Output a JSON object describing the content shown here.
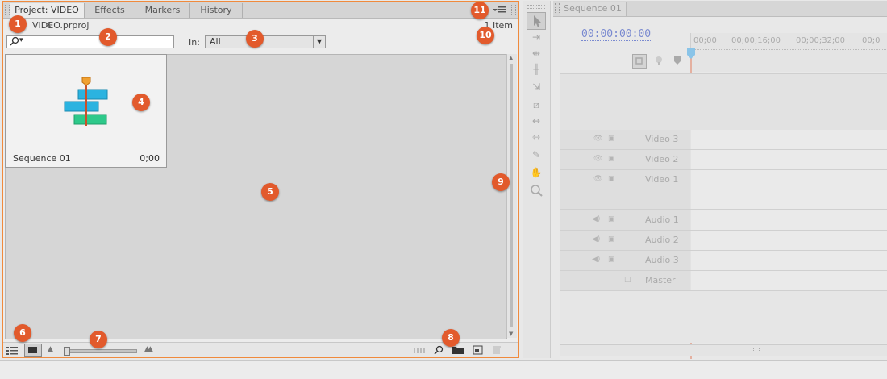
{
  "project_panel": {
    "tabs": [
      {
        "label": "Project: VIDEO",
        "close": "×"
      },
      {
        "label": "Effects"
      },
      {
        "label": "Markers"
      },
      {
        "label": "History"
      }
    ],
    "menu_icon": "panel-menu-icon",
    "project_file": "VIDEO.prproj",
    "item_count": "1 Item",
    "search": {
      "icon": "search-icon",
      "dropdown": "▾",
      "value": ""
    },
    "filter": {
      "label": "In:",
      "selected": "All"
    },
    "items": [
      {
        "name": "Sequence 01",
        "duration": "0;00",
        "icon": "sequence-icon"
      }
    ],
    "bottom_bar": {
      "list_view_icon": "list-view-icon",
      "icon_view_icon": "icon-view-icon",
      "zoom_level": 0.0,
      "tools": [
        "automate-to-sequence-icon",
        "find-icon",
        "new-bin-icon",
        "new-item-icon",
        "delete-icon"
      ]
    }
  },
  "callouts": [
    "1",
    "2",
    "3",
    "4",
    "5",
    "6",
    "7",
    "8",
    "9",
    "10",
    "11"
  ],
  "timeline": {
    "tab": "Sequence 01",
    "timecode": "00:00:00:00",
    "ruler": [
      "00;00",
      "00;00;16;00",
      "00;00;32;00",
      "00;0"
    ],
    "video_tracks": [
      "Video 3",
      "Video 2",
      "Video 1"
    ],
    "audio_tracks": [
      "Audio 1",
      "Audio 2",
      "Audio 3"
    ],
    "master": "Master"
  },
  "colors": {
    "accent": "#f08a3c",
    "callout": "#e25a2c",
    "seq_blue": "#2bb3e0",
    "seq_green": "#2ec98a",
    "timecode": "#7a8ad0"
  }
}
